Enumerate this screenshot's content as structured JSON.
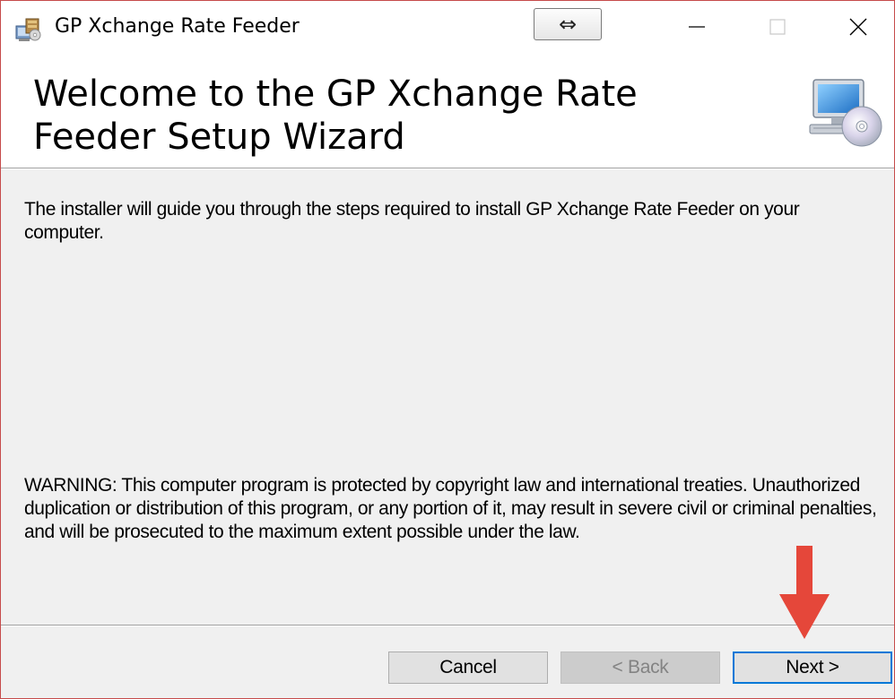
{
  "window": {
    "title": "GP Xchange Rate Feeder"
  },
  "titlebar": {
    "snap_glyph": "⇔",
    "minimize_icon": "minimize-icon",
    "maximize_icon": "maximize-icon",
    "close_icon": "close-icon"
  },
  "header": {
    "title": "Welcome to the GP Xchange Rate Feeder Setup Wizard",
    "icon": "computer-disc-icon"
  },
  "body": {
    "intro": "The installer will guide you through the steps required to install GP Xchange Rate Feeder on your computer.",
    "warning": "WARNING: This computer program is protected by copyright law and international treaties. Unauthorized duplication or distribution of this program, or any portion of it, may result in severe civil or criminal penalties, and will be prosecuted to the maximum extent possible under the law."
  },
  "buttons": {
    "cancel": "Cancel",
    "back": "< Back",
    "next": "Next >",
    "back_enabled": false,
    "default_button": "next"
  },
  "annotation": {
    "icon": "red-arrow-down-icon",
    "color": "#e5473a"
  },
  "colors": {
    "accent": "#0078d7",
    "dialog_bg": "#f0f0f0",
    "window_border": "#c64b4b"
  }
}
